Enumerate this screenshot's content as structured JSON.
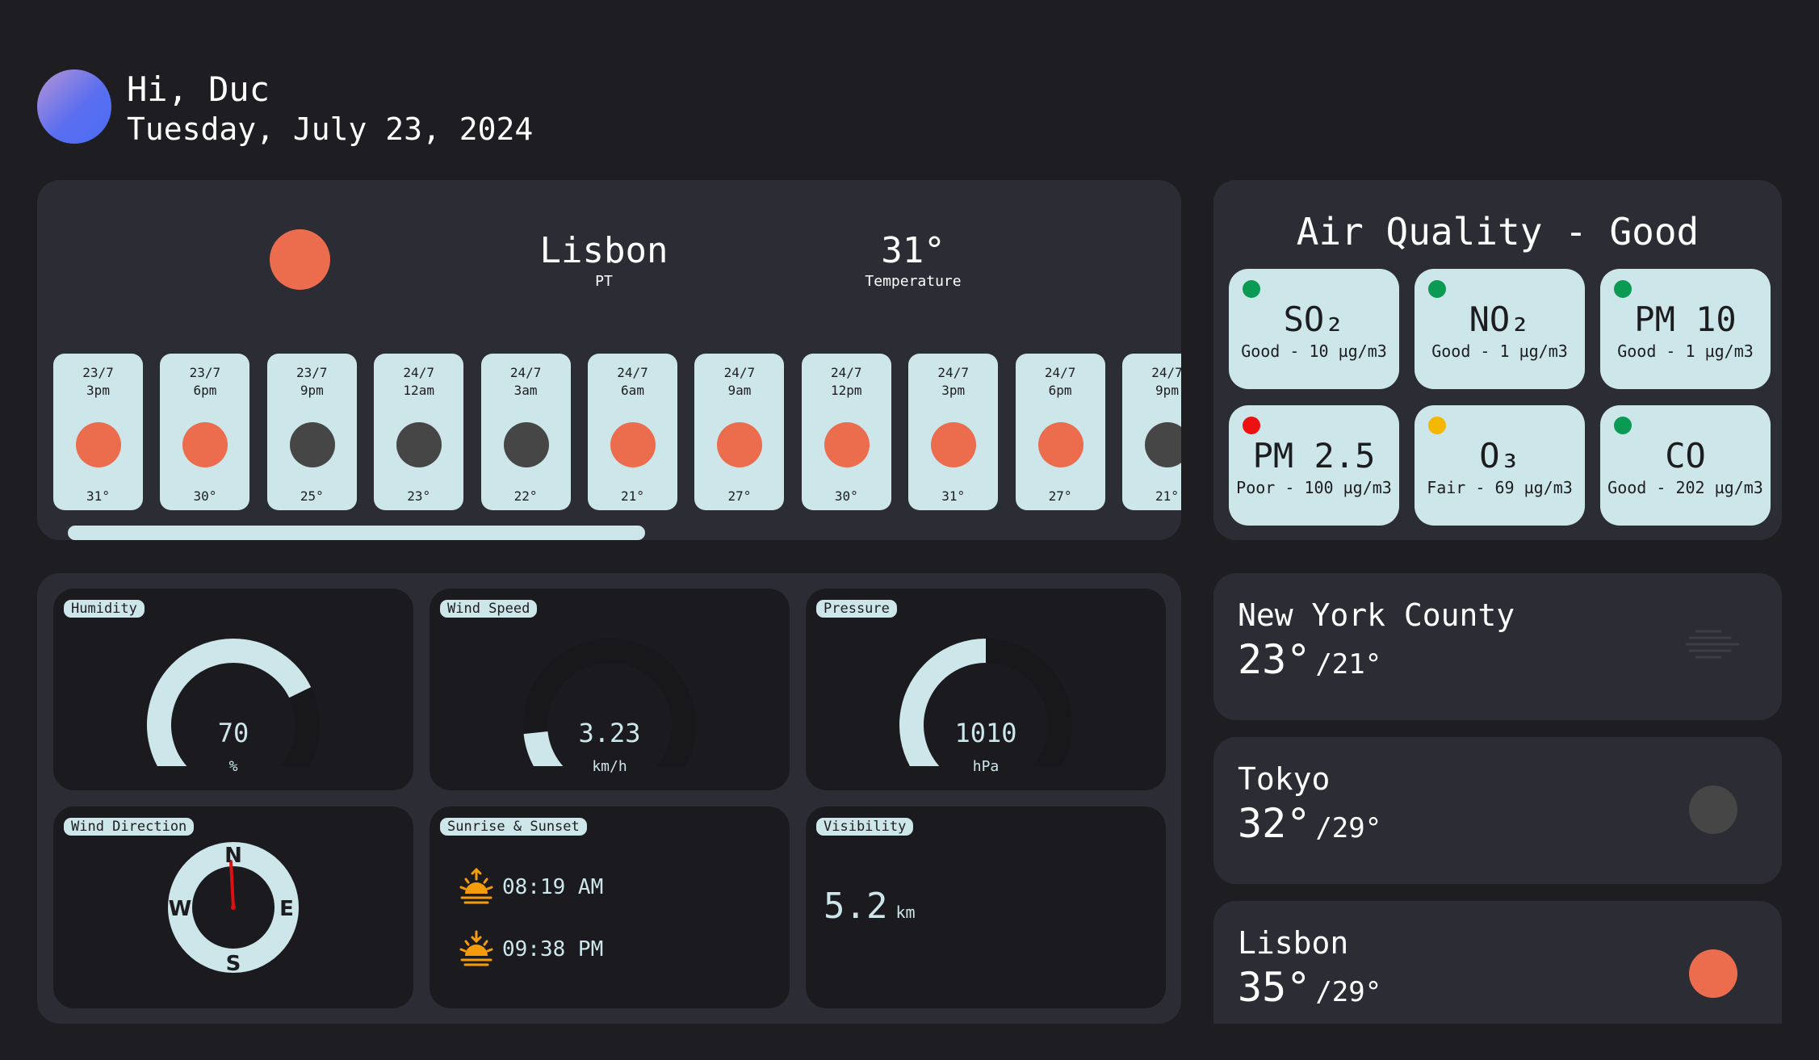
{
  "header": {
    "greeting": "Hi, Duc",
    "date": "Tuesday, July 23, 2024"
  },
  "current": {
    "city": "Lisbon",
    "country": "PT",
    "temperature": "31°",
    "temperature_label": "Temperature",
    "icon": "sun-icon"
  },
  "hourly": [
    {
      "date": "23/7",
      "time": "3pm",
      "temp": "31°",
      "icon": "sun-icon"
    },
    {
      "date": "23/7",
      "time": "6pm",
      "temp": "30°",
      "icon": "sun-icon"
    },
    {
      "date": "23/7",
      "time": "9pm",
      "temp": "25°",
      "icon": "moon-icon"
    },
    {
      "date": "24/7",
      "time": "12am",
      "temp": "23°",
      "icon": "moon-icon"
    },
    {
      "date": "24/7",
      "time": "3am",
      "temp": "22°",
      "icon": "moon-icon"
    },
    {
      "date": "24/7",
      "time": "6am",
      "temp": "21°",
      "icon": "sun-icon"
    },
    {
      "date": "24/7",
      "time": "9am",
      "temp": "27°",
      "icon": "sun-icon"
    },
    {
      "date": "24/7",
      "time": "12pm",
      "temp": "30°",
      "icon": "sun-icon"
    },
    {
      "date": "24/7",
      "time": "3pm",
      "temp": "31°",
      "icon": "sun-icon"
    },
    {
      "date": "24/7",
      "time": "6pm",
      "temp": "27°",
      "icon": "sun-icon"
    },
    {
      "date": "24/7",
      "time": "9pm",
      "temp": "21°",
      "icon": "moon-icon"
    }
  ],
  "air_quality": {
    "title": "Air Quality - Good",
    "items": [
      {
        "name": "SO₂",
        "status": "Good - 10 µg/m3",
        "color": "#0a9a53"
      },
      {
        "name": "NO₂",
        "status": "Good - 1 µg/m3",
        "color": "#0a9a53"
      },
      {
        "name": "PM 10",
        "status": "Good - 1 µg/m3",
        "color": "#0a9a53"
      },
      {
        "name": "PM 2.5",
        "status": "Poor - 100 µg/m3",
        "color": "#ee1111"
      },
      {
        "name": "O₃",
        "status": "Fair - 69 µg/m3",
        "color": "#f5b800"
      },
      {
        "name": "CO",
        "status": "Good - 202 µg/m3",
        "color": "#0a9a53"
      }
    ]
  },
  "metrics": {
    "humidity": {
      "label": "Humidity",
      "value": "70",
      "unit": "%",
      "fraction": 0.7
    },
    "wind_speed": {
      "label": "Wind Speed",
      "value": "3.23",
      "unit": "km/h",
      "fraction": 0.2
    },
    "pressure": {
      "label": "Pressure",
      "value": "1010",
      "unit": "hPa",
      "fraction": 0.5
    },
    "wind_direction": {
      "label": "Wind Direction",
      "n": "N",
      "e": "E",
      "s": "S",
      "w": "W"
    },
    "sun": {
      "label": "Sunrise & Sunset",
      "sunrise": "08:19 AM",
      "sunset": "09:38 PM"
    },
    "visibility": {
      "label": "Visibility",
      "value": "5.2",
      "unit": "km"
    }
  },
  "other_cities": [
    {
      "name": "New York County",
      "temp": "23°",
      "low": "/21°",
      "icon": "mist-icon"
    },
    {
      "name": "Tokyo",
      "temp": "32°",
      "low": "/29°",
      "icon": "moon-icon"
    },
    {
      "name": "Lisbon",
      "temp": "35°",
      "low": "/29°",
      "icon": "sun-icon"
    }
  ],
  "colors": {
    "background": "#1e1e22",
    "panel": "#2c2c34",
    "card_light": "#cce6ea",
    "sun": "#ec6d4e",
    "night": "#464646"
  }
}
